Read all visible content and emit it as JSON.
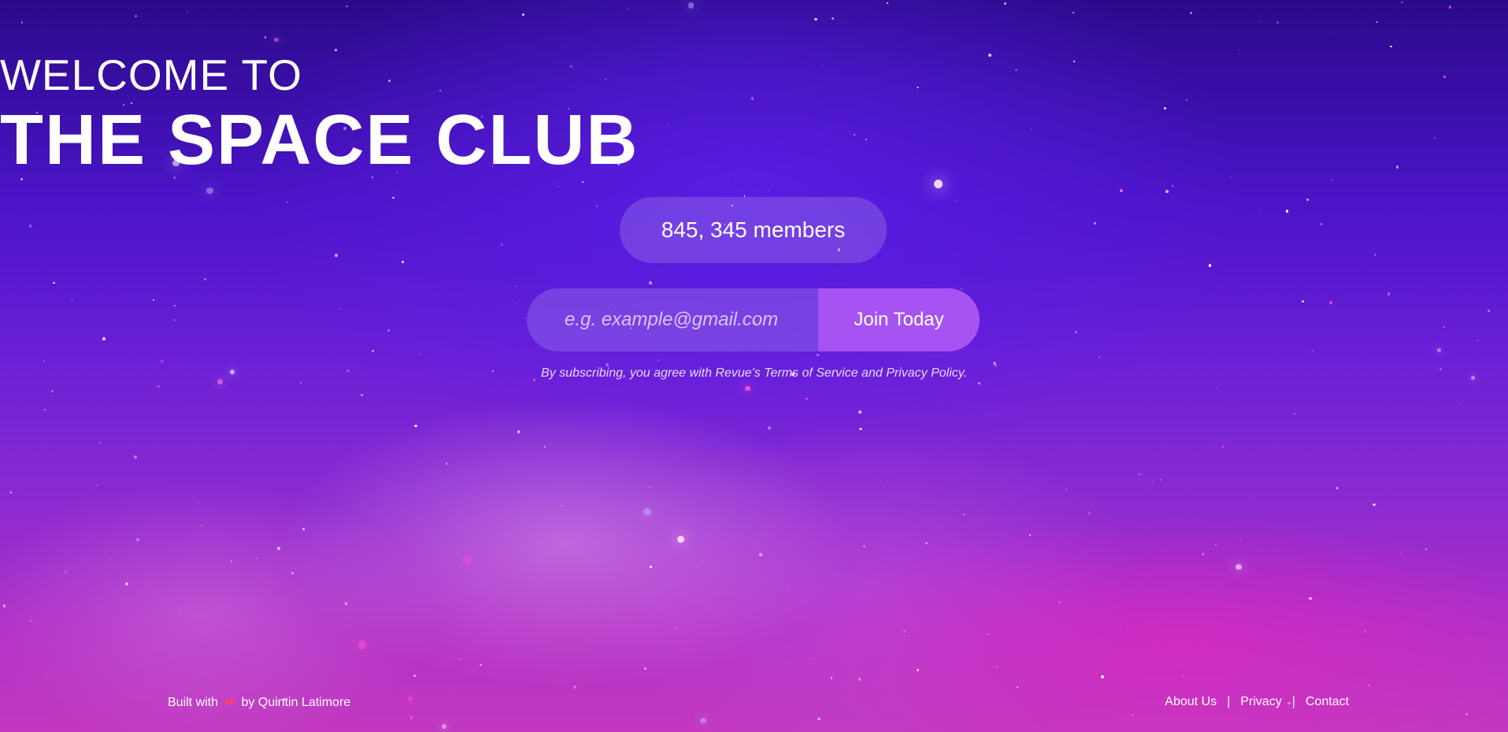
{
  "hero": {
    "welcome": "WELCOME TO",
    "title": "THE SPACE CLUB",
    "members": "845, 345 members"
  },
  "signup": {
    "email_placeholder": "e.g. example@gmail.com",
    "join_label": "Join Today",
    "terms": "By subscribing, you agree with Revue's Terms of Service and Privacy Policy."
  },
  "footer": {
    "built_with": "Built with",
    "heart_icon": "heart-icon",
    "author": "by Quintin Latimore",
    "links": {
      "about": "About Us",
      "privacy": "Privacy",
      "contact": "Contact"
    },
    "separator": "|"
  },
  "colors": {
    "accent": "#a752f2",
    "heart": "#ff3e6c"
  }
}
